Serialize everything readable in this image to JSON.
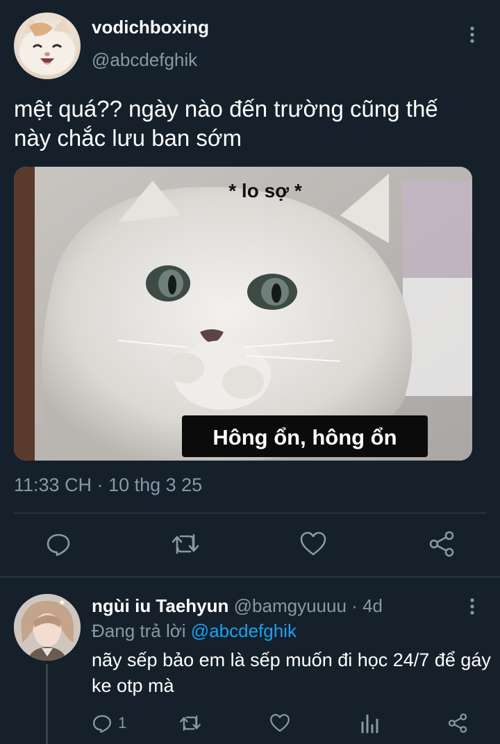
{
  "tweet": {
    "display_name": "vodichboxing",
    "handle": "@abcdefghik",
    "text": "mệt quá?? ngày nào đến trường cũng thế\nnày chắc lưu ban sớm",
    "media": {
      "top_caption": "* lo sợ *",
      "bottom_caption": "Hông ổn, hông ổn"
    },
    "timestamp": "11:33 CH · 10 thg 3 25",
    "actions": [
      "reply-icon",
      "retweet-icon",
      "like-icon",
      "share-icon"
    ]
  },
  "reply": {
    "display_name": "ngùi iu Taehyun",
    "handle": "@bamgyuuuu",
    "separator": "·",
    "age": "4d",
    "replying_prefix": "Đang trả lời",
    "replying_to": "@abcdefghik",
    "text": "nãy sếp bảo em là sếp muốn đi học 24/7 để gáy ke otp mà",
    "reply_count": "1",
    "actions": [
      "reply-icon",
      "retweet-icon",
      "like-icon",
      "analytics-icon",
      "share-icon"
    ]
  },
  "colors": {
    "background": "#15202b",
    "text": "#ffffff",
    "muted": "#8899a6",
    "link": "#1da1f2",
    "divider": "#38444d"
  }
}
